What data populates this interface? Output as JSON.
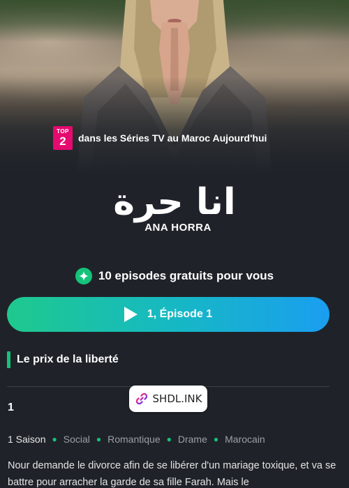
{
  "hero": {
    "image_alt": "Woman with blond hair and hands clasped, wearing a shawl"
  },
  "ranking": {
    "badge_top": "TOP",
    "badge_number": "2",
    "text": "dans les Séries TV au Maroc Aujourd'hui"
  },
  "show": {
    "title_arabic": "انا حرة",
    "title_latin": "ANA HORRA",
    "tagline": "Le prix de la liberté"
  },
  "offer": {
    "text": "10 episodes gratuits pour vous"
  },
  "play_button": {
    "label": "1, Épisode 1"
  },
  "season": {
    "selected": "1"
  },
  "watermark": {
    "text": "SHDL.INK"
  },
  "meta": {
    "seasons": "1 Saison",
    "genres": [
      "Social",
      "Romantique",
      "Drame",
      "Marocain"
    ]
  },
  "description": "Nour demande le divorce afin de se libérer d'un mariage toxique, et va se battre pour arracher la garde de sa fille Farah. Mais le",
  "colors": {
    "accent_green": "#15c37a",
    "badge_pink": "#e50a6f",
    "background": "#1f2329",
    "button_gradient_start": "#1fc98d",
    "button_gradient_end": "#1a9ef0"
  },
  "icons": {
    "offer": "sparkle-icon",
    "play": "play-icon",
    "watermark": "link-icon"
  }
}
